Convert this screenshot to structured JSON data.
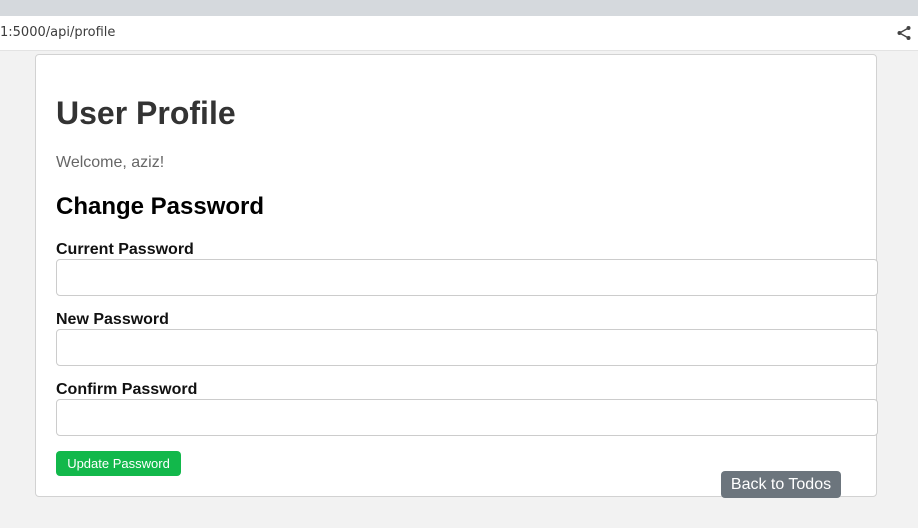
{
  "browser": {
    "url": "1:5000/api/profile",
    "share_icon": "share-icon"
  },
  "profile": {
    "title": "User Profile",
    "welcome": "Welcome, aziz!",
    "change_password_heading": "Change Password",
    "fields": [
      {
        "label": "Current Password",
        "value": "",
        "placeholder": ""
      },
      {
        "label": "New Password",
        "value": "",
        "placeholder": ""
      },
      {
        "label": "Confirm Password",
        "value": "",
        "placeholder": ""
      }
    ],
    "update_button_label": "Update Password",
    "back_button_label": "Back to Todos"
  },
  "colors": {
    "primary_green": "#12b84b",
    "secondary_gray": "#6c757d",
    "page_background": "#f2f2f2"
  }
}
